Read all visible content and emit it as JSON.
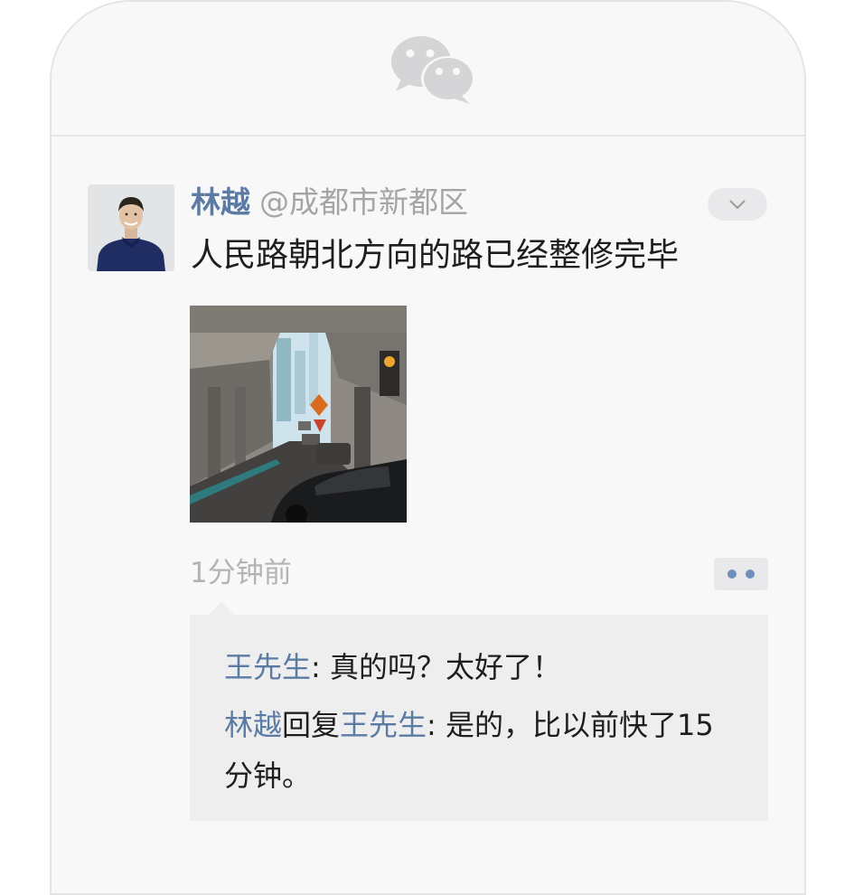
{
  "app": {
    "logo_icon": "wechat-logo-icon"
  },
  "post": {
    "author": "林越",
    "location": "@成都市新都区",
    "text": "人民路朝北方向的路已经整修完毕",
    "time": "1分钟前",
    "fold_icon": "chevron-down-icon",
    "more_icon": "more-dots-icon",
    "image_icon": "overpass-street-photo"
  },
  "comments": [
    {
      "author": "王先生",
      "separator": ": ",
      "text": "真的吗？太好了！"
    },
    {
      "author": "林越",
      "reply_word": "回复",
      "reply_to": "王先生",
      "separator": ": ",
      "text": "是的，比以前快了15分钟。"
    }
  ],
  "colors": {
    "name_link": "#5b7ba5",
    "body_text": "#1e1e1e",
    "muted_text": "#a5a5a5",
    "background": "#f8f8f9",
    "comments_bg": "#eeeeef"
  }
}
